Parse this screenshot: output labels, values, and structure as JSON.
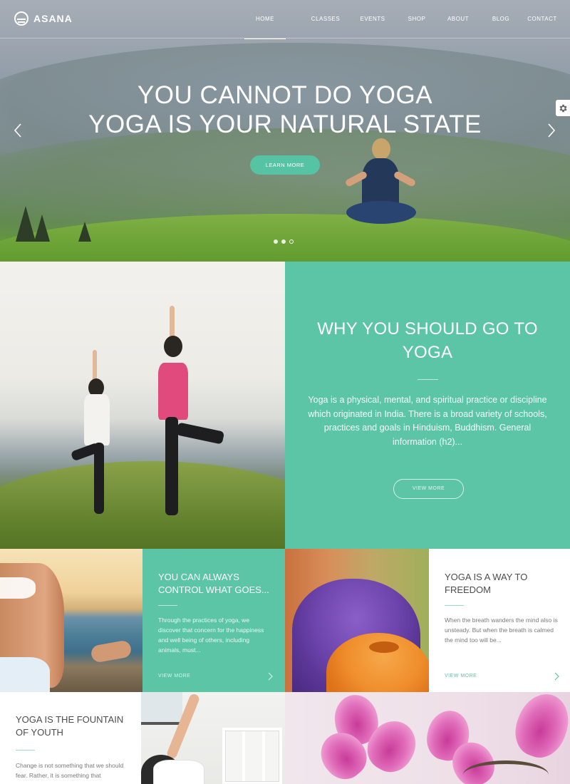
{
  "brand": {
    "name": "ASANA"
  },
  "nav": {
    "items": [
      {
        "label": "HOME",
        "active": true
      },
      {
        "label": "CLASSES",
        "active": false
      },
      {
        "label": "EVENTS",
        "active": false
      },
      {
        "label": "SHOP",
        "active": false
      },
      {
        "label": "ABOUT",
        "active": false
      },
      {
        "label": "BLOG",
        "active": false
      },
      {
        "label": "CONTACT",
        "active": false
      }
    ]
  },
  "hero": {
    "line1": "YOU CANNOT DO YOGA",
    "line2": "YOGA IS YOUR NATURAL STATE",
    "button": "LEARN MORE",
    "slides_total": 3,
    "active_slide": 3
  },
  "why": {
    "title": "WHY YOU SHOULD GO TO YOGA",
    "text": "Yoga is a physical, mental, and spiritual practice or discipline which originated in India. There is a broad variety of schools, practices and goals in Hinduism, Buddhism. General information (h2)...",
    "button": "VIEW MORE"
  },
  "cards": [
    {
      "title": "YOU CAN ALWAYS CONTROL WHAT GOES...",
      "text": "Through the practices of yoga, we discover that concern for the happiness and well being of others, including animals, must...",
      "link": "VIEW MORE"
    },
    {
      "title": "YOGA IS A WAY TO FREEDOM",
      "text": "When the breath wanders the mind also is unsteady. But when the breath is calmed the mind too will be...",
      "link": "VIEW MORE"
    },
    {
      "title": "YOGA IS THE FOUNTAIN OF YOUTH",
      "text": "Change is not something that we should fear. Rather, it is something that"
    }
  ],
  "colors": {
    "accent": "#5bc5a5",
    "white": "#ffffff",
    "text_dark": "#4c4c4c"
  },
  "icons": {
    "logo": "sun-horizon-icon",
    "prev": "chevron-left-icon",
    "next": "chevron-right-icon",
    "settings": "gear-icon",
    "card_arrow": "chevron-right-icon"
  }
}
